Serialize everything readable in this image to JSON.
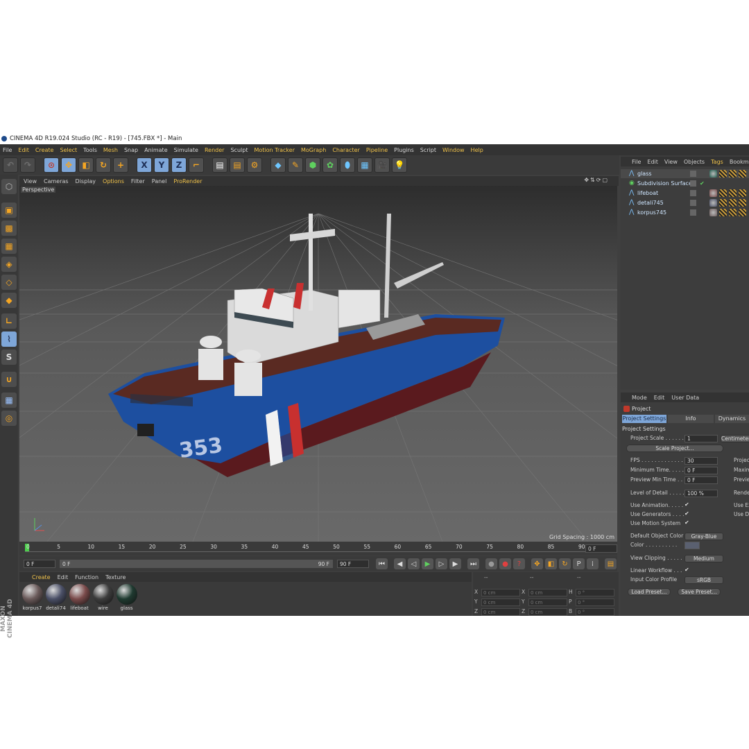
{
  "window": {
    "title": "CINEMA 4D R19.024 Studio (RC - R19) - [745.FBX *] - Main"
  },
  "menubar": [
    "File",
    "Edit",
    "Create",
    "Select",
    "Tools",
    "Mesh",
    "Snap",
    "Animate",
    "Simulate",
    "Render",
    "Sculpt",
    "Motion Tracker",
    "MoGraph",
    "Character",
    "Pipeline",
    "Plugins",
    "Script",
    "Window",
    "Help"
  ],
  "toolbar": {
    "axis_x": "X",
    "axis_y": "Y",
    "axis_z": "Z"
  },
  "viewport": {
    "menu": [
      "View",
      "Cameras",
      "Display",
      "Options",
      "Filter",
      "Panel",
      "ProRender"
    ],
    "label": "Perspective",
    "grid_spacing": "Grid Spacing : 1000 cm",
    "hull_number": "353"
  },
  "timeline": {
    "ticks": [
      "0",
      "5",
      "10",
      "15",
      "20",
      "25",
      "30",
      "35",
      "40",
      "45",
      "50",
      "55",
      "60",
      "65",
      "70",
      "75",
      "80",
      "85",
      "90"
    ],
    "current_frame": "0 F",
    "start": "0 F",
    "range_start": "0 F",
    "range_end": "90 F",
    "end": "90 F"
  },
  "materials": {
    "menu": [
      "Create",
      "Edit",
      "Function",
      "Texture"
    ],
    "items": [
      {
        "name": "korpus7",
        "color": "#6a5a5a"
      },
      {
        "name": "detali74",
        "color": "#4a4f66"
      },
      {
        "name": "lifeboat",
        "color": "#7a4a4a"
      },
      {
        "name": "wire",
        "color": "#3c3c3c"
      },
      {
        "name": "glass",
        "color": "#1f3a30"
      }
    ]
  },
  "coords": {
    "header": [
      "--",
      "--",
      "--"
    ],
    "rows": [
      {
        "a": "X",
        "v1": "0 cm",
        "b": "X",
        "v2": "0 cm",
        "c": "H",
        "v3": "0 °"
      },
      {
        "a": "Y",
        "v1": "0 cm",
        "b": "Y",
        "v2": "0 cm",
        "c": "P",
        "v3": "0 °"
      },
      {
        "a": "Z",
        "v1": "0 cm",
        "b": "Z",
        "v2": "0 cm",
        "c": "B",
        "v3": "0 °"
      }
    ]
  },
  "objects": {
    "menu": [
      "File",
      "Edit",
      "View",
      "Objects",
      "Tags",
      "Bookmarks"
    ],
    "items": [
      {
        "name": "glass"
      },
      {
        "name": "Subdivision Surface"
      },
      {
        "name": "lifeboat"
      },
      {
        "name": "detali745"
      },
      {
        "name": "korpus745"
      }
    ]
  },
  "attributes": {
    "menu": [
      "Mode",
      "Edit",
      "User Data"
    ],
    "object": "Project",
    "tabs": [
      "Project Settings",
      "Info",
      "Dynamics"
    ],
    "section": "Project Settings",
    "project_scale_label": "Project Scale . . . . . .",
    "project_scale_value": "1",
    "project_scale_unit": "Centimeters",
    "scale_project_button": "Scale Project...",
    "fps_label": "FPS . . . . . . . . . . . . . .",
    "fps_value": "30",
    "min_time_label": "Minimum Time. . . . .",
    "min_time_value": "0 F",
    "preview_min_label": "Preview Min Time . .",
    "preview_min_value": "0 F",
    "lod_label": "Level of Detail . . . . .",
    "lod_value": "100 %",
    "right_labels": [
      "Project",
      "Maxim",
      "Previe",
      "Rende",
      "Use Ex",
      "Use D"
    ],
    "use_animation": "Use Animation. . . . .",
    "use_generators": "Use Generators . . . .",
    "use_motion": "Use Motion System",
    "default_color_label": "Default Object Color",
    "default_color_value": "Gray-Blue",
    "color_label": "Color . . . . . . . . . .",
    "view_clipping_label": "View Clipping . . . . .",
    "view_clipping_value": "Medium",
    "linear_workflow": "Linear Workflow . . .",
    "input_color_label": "Input Color Profile",
    "input_color_value": "sRGB",
    "load_preset": "Load Preset...",
    "save_preset": "Save Preset..."
  },
  "branding": "MAXON CINEMA 4D"
}
